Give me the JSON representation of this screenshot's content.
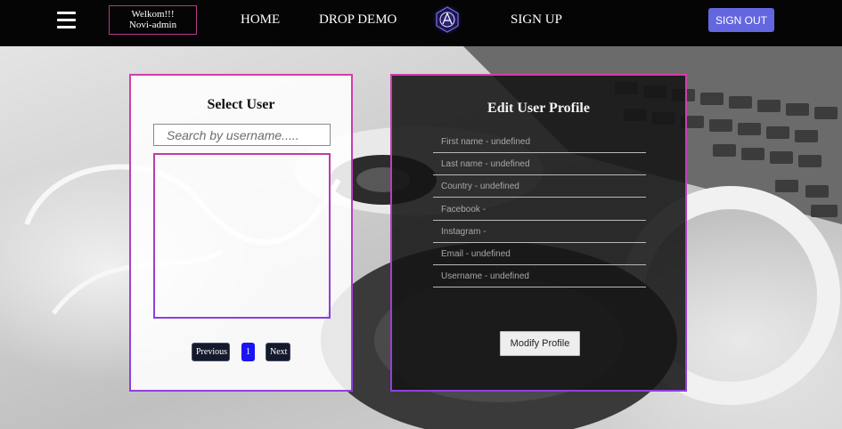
{
  "navbar": {
    "menu_icon": "hamburger-menu-icon",
    "welcome_line1": "Welkom!!!",
    "welcome_line2": "Novi-admin",
    "links": {
      "home": "HOME",
      "drop_demo": "DROP DEMO",
      "sign_up": "SIGN UP"
    },
    "logo_icon": "brand-logo-icon",
    "sign_out": "SIGN OUT"
  },
  "select_user": {
    "title": "Select User",
    "search_placeholder": "Search by username.....",
    "search_value": "",
    "pagination": {
      "previous": "Previous",
      "current_page": "1",
      "next": "Next"
    }
  },
  "edit_profile": {
    "title": "Edit User Profile",
    "fields": [
      {
        "placeholder": "First name - undefined"
      },
      {
        "placeholder": "Last name - undefined"
      },
      {
        "placeholder": "Country - undefined"
      },
      {
        "placeholder": "Facebook -"
      },
      {
        "placeholder": "Instagram -"
      },
      {
        "placeholder": "Email - undefined"
      },
      {
        "placeholder": "Username - undefined"
      }
    ],
    "modify_button": "Modify Profile"
  },
  "colors": {
    "navbar_bg": "#050505",
    "accent_purple": "#6466e0",
    "panel_border_pink": "#d23ea8",
    "panel_border_violet": "#8f3fe0",
    "page_active": "#1a14f5"
  }
}
